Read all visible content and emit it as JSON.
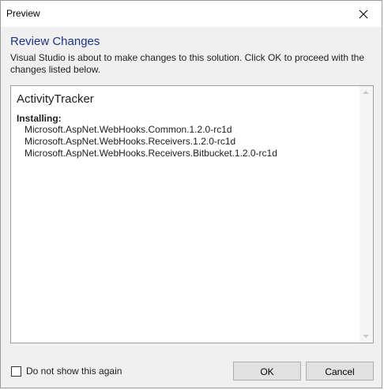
{
  "window": {
    "title": "Preview"
  },
  "icons": {
    "close": "close-icon",
    "scroll_up": "scroll-up-arrow-icon",
    "scroll_down": "scroll-down-arrow-icon"
  },
  "header": {
    "heading": "Review Changes",
    "description": "Visual Studio is about to make changes to this solution. Click OK to proceed with the changes listed below."
  },
  "changes": {
    "project": "ActivityTracker",
    "section_title": "Installing:",
    "packages": [
      "Microsoft.AspNet.WebHooks.Common.1.2.0-rc1d",
      "Microsoft.AspNet.WebHooks.Receivers.1.2.0-rc1d",
      "Microsoft.AspNet.WebHooks.Receivers.Bitbucket.1.2.0-rc1d"
    ]
  },
  "footer": {
    "checkbox_label": "Do not show this again",
    "checkbox_checked": false,
    "ok_label": "OK",
    "cancel_label": "Cancel"
  },
  "colors": {
    "heading": "#1e3287",
    "dialog_background": "#f0f0f0",
    "button_background": "#e1e1e1"
  }
}
